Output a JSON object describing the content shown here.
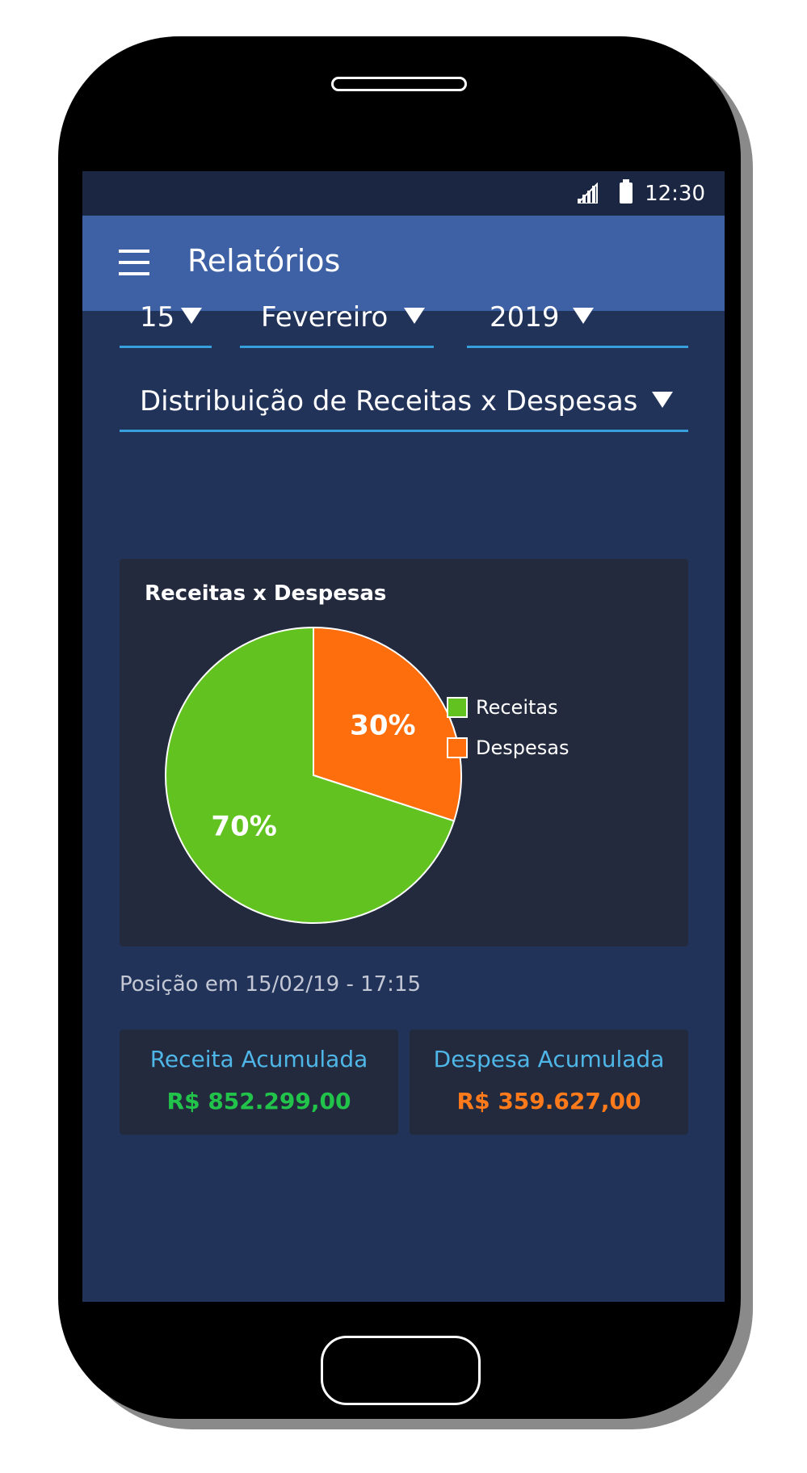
{
  "status_bar": {
    "time": "12:30"
  },
  "app_bar": {
    "title": "Relatórios"
  },
  "filters": {
    "day": "15",
    "month": "Fevereiro",
    "year": "2019",
    "report_type": "Distribuição de Receitas x Despesas"
  },
  "chart_data": {
    "type": "pie",
    "title": "Receitas x Despesas",
    "categories": [
      "Receitas",
      "Despesas"
    ],
    "values": [
      70,
      30
    ],
    "labels": [
      "70%",
      "30%"
    ],
    "colors": [
      "#62c320",
      "#ff6e0c"
    ],
    "legend": "right"
  },
  "summary": {
    "timestamp": "Posição em 15/02/19 - 17:15",
    "revenue_label": "Receita Acumulada",
    "revenue_value": "R$ 852.299,00",
    "expense_label": "Despesa Acumulada",
    "expense_value": "R$ 359.627,00"
  },
  "colors": {
    "accent": "#37a0dc",
    "appbar": "#3e61a5",
    "revenue": "#22c34a",
    "expense": "#ff7a1a"
  }
}
